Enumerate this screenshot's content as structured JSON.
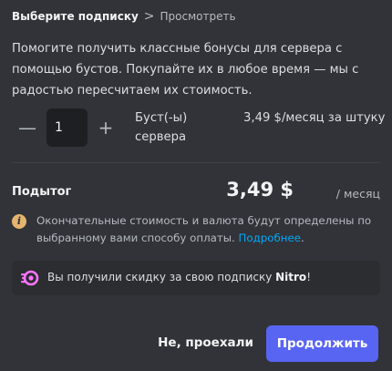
{
  "breadcrumb": {
    "current": "Выберите подписку",
    "separator": ">",
    "next": "Просмотреть"
  },
  "description": "Помогите получить классные бонусы для сервера с помощью бустов. Покупайте их в любое время — мы с радостью пересчитаем их стоимость.",
  "quantity": {
    "minus": "—",
    "plus": "+",
    "value": "1",
    "label": "Буст(-ы) сервера",
    "price": "3,49 $/месяц за штуку"
  },
  "subtotal": {
    "label": "Подытог",
    "amount": "3,49 $",
    "period": "/ месяц"
  },
  "info": {
    "icon": "i",
    "text": "Окончательные стоимость и валюта будут определены по выбранному вами способу оплаты. ",
    "link": "Подробнее",
    "after": "."
  },
  "nitro": {
    "text_before": "Вы получили скидку за свою подписку ",
    "brand": "Nitro",
    "text_after": "!",
    "icon_color": "#ff73fa"
  },
  "footer": {
    "cancel": "Не, проехали",
    "continue": "Продолжить"
  },
  "colors": {
    "background": "#313338",
    "accent": "#5865f2",
    "link": "#00a8fc",
    "warning": "#e5b46e"
  }
}
